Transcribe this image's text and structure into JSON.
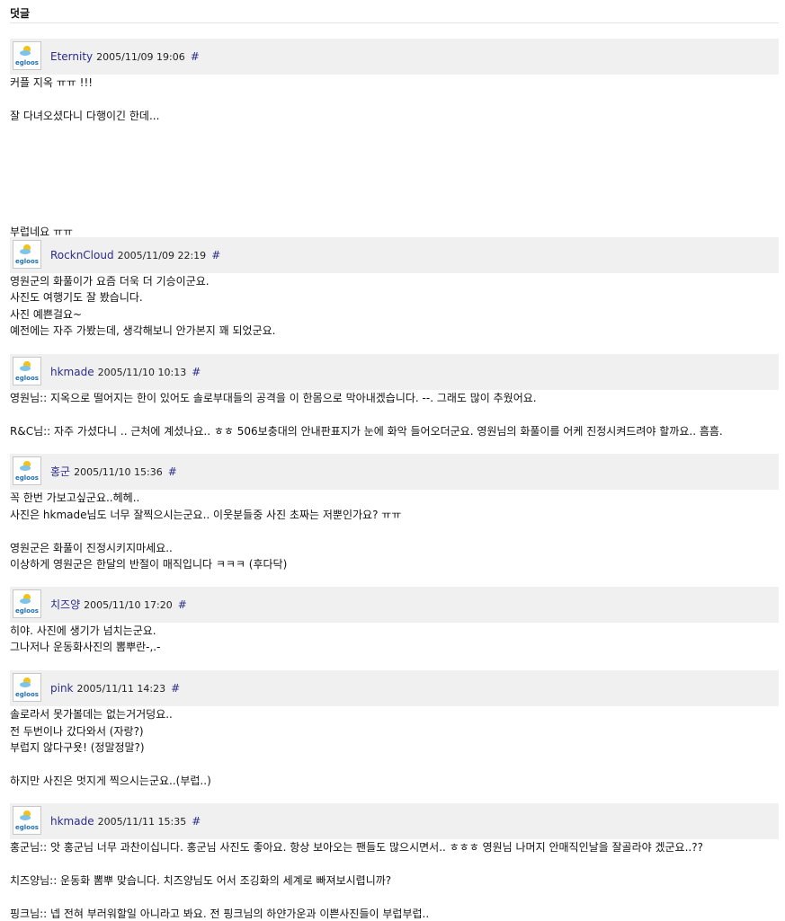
{
  "section": {
    "title": "덧글"
  },
  "avatar_text": "egloos",
  "comments": [
    {
      "author": "Eternity",
      "date": "2005/11/09 19:06",
      "permalink": "#",
      "lines": [
        "커플 지옥 ㅠㅠ !!!",
        "",
        "잘 다녀오셨다니 다행이긴 한데...",
        "",
        "",
        "",
        "",
        "",
        "",
        "부럽네요 ㅠㅠ"
      ]
    },
    {
      "author": "RocknCloud",
      "date": "2005/11/09 22:19",
      "permalink": "#",
      "lines": [
        "영원군의 화풀이가 요즘 더욱 더 기승이군요.",
        "사진도 여행기도 잘 봤습니다.",
        "사진 예쁜걸요~",
        "예전에는 자주 가봤는데, 생각해보니 안가본지 꽤 되었군요."
      ]
    },
    {
      "author": "hkmade",
      "date": "2005/11/10 10:13",
      "permalink": "#",
      "lines": [
        "영원님:: 지옥으로 떨어지는 한이 있어도 솔로부대들의 공격을 이 한몸으로 막아내겠습니다. --. 그래도 많이 추웠어요.",
        "",
        "R&C님:: 자주 가셨다니 .. 근처에 계셨나요.. ㅎㅎ 506보충대의 안내판표지가 눈에 화악 들어오더군요. 영원님의 화풀이를 어케 진정시켜드려야 할까요.. 흠흠."
      ]
    },
    {
      "author": "홍군",
      "date": "2005/11/10 15:36",
      "permalink": "#",
      "lines": [
        "꼭 한번 가보고싶군요..헤헤..",
        "사진은 hkmade님도 너무 잘찍으시는군요.. 이웃분들중 사진 초짜는 저뿐인가요? ㅠㅠ",
        "",
        "영원군은 화풀이 진정시키지마세요..",
        "이상하게 영원군은 한달의 반절이 매직입니다 ㅋㅋㅋ (후다닥)"
      ]
    },
    {
      "author": "치즈양",
      "date": "2005/11/10 17:20",
      "permalink": "#",
      "lines": [
        "히야. 사진에 생기가 넘치는군요.",
        "그나저나 운동화사진의 뽐뿌란-,.-"
      ]
    },
    {
      "author": "pink",
      "date": "2005/11/11 14:23",
      "permalink": "#",
      "lines": [
        "솔로라서 못가볼데는 없는거거덩요..",
        "전 두번이나 갔다와서 (자랑?)",
        "부럽지 않다구욧! (정말정말?)",
        "",
        "하지만 사진은 멋지게 찍으시는군요..(부럽..)"
      ]
    },
    {
      "author": "hkmade",
      "date": "2005/11/11 15:35",
      "permalink": "#",
      "lines": [
        "홍군님:: 앗 홍군님 너무 과찬이십니다. 홍군님 사진도 좋아요. 항상 보아오는 팬들도 많으시면서.. ㅎㅎㅎ 영원님 나머지 안매직인날을 잘골라야 겠군요..??",
        "",
        "치즈양님:: 운동화 뽐뿌 맞습니다. 치즈양님도 어서 조깅화의 세계로 빠져보시렵니까?",
        "",
        "핑크님:: 넵 전혀 부러워할일 아니라고 봐요. 전 핑크님의 하얀가운과 이쁜사진들이 부럽부럽.."
      ]
    }
  ]
}
